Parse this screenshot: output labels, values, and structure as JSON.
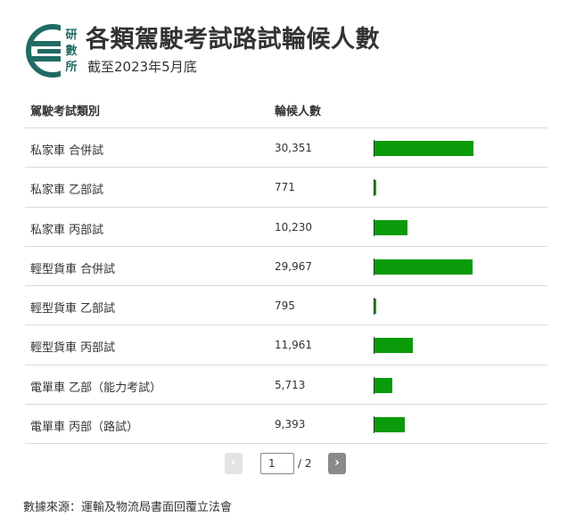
{
  "header": {
    "logo_text": [
      "研",
      "數",
      "所"
    ],
    "title": "各類駕駛考試路試輪候人數",
    "subtitle": "截至2023年5月底"
  },
  "colors": {
    "bar": "#0a9a0a",
    "logo": "#1f6b63"
  },
  "table": {
    "col_type": "駕駛考試類別",
    "col_count": "輪候人數"
  },
  "chart_data": {
    "type": "bar",
    "categories": [
      "私家車 合併試",
      "私家車 乙部試",
      "私家車 丙部試",
      "輕型貨車 合併試",
      "輕型貨車 乙部試",
      "輕型貨車 丙部試",
      "電單車 乙部（能力考試）",
      "電單車 丙部（路試）"
    ],
    "values": [
      30351,
      771,
      10230,
      29967,
      795,
      11961,
      5713,
      9393
    ],
    "value_labels": [
      "30,351",
      "771",
      "10,230",
      "29,967",
      "795",
      "11,961",
      "5,713",
      "9,393"
    ],
    "title": "各類駕駛考試路試輪候人數",
    "xlabel": "駕駛考試類別",
    "ylabel": "輪候人數",
    "max": 30351
  },
  "pager": {
    "prev": "‹",
    "next": "›",
    "current": "1",
    "total": "/ 2"
  },
  "source": "數據來源：運輸及物流局書面回覆立法會"
}
